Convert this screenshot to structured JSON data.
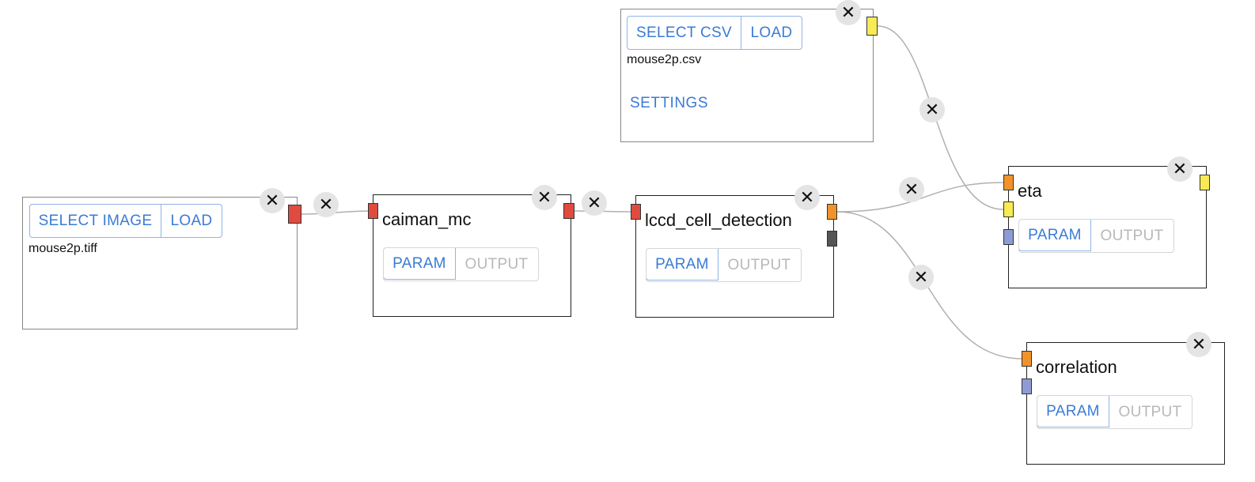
{
  "colors": {
    "port_image": "#e04b3f",
    "port_csv": "#f8ea55",
    "port_roi": "#f0932b",
    "port_iscell": "#555555",
    "port_input_aux": "#8e9bd4",
    "button_text": "#3a7bd5",
    "edge": "#b0b0b0"
  },
  "close_glyph": "✕",
  "nodes": {
    "image_input": {
      "select_label": "SELECT IMAGE",
      "load_label": "LOAD",
      "filename": "mouse2p.tiff"
    },
    "csv_input": {
      "select_label": "SELECT CSV",
      "load_label": "LOAD",
      "filename": "mouse2p.csv",
      "settings_label": "SETTINGS"
    },
    "caiman_mc": {
      "title": "caiman_mc",
      "param_label": "PARAM",
      "output_label": "OUTPUT"
    },
    "lccd": {
      "title": "lccd_cell_detection",
      "param_label": "PARAM",
      "output_label": "OUTPUT"
    },
    "eta": {
      "title": "eta",
      "param_label": "PARAM",
      "output_label": "OUTPUT"
    },
    "correlation": {
      "title": "correlation",
      "param_label": "PARAM",
      "output_label": "OUTPUT"
    }
  },
  "edges": [
    {
      "id": "image-to-caiman",
      "from": "image_input.output",
      "to": "caiman_mc.input"
    },
    {
      "id": "caiman-to-lccd",
      "from": "caiman_mc.output",
      "to": "lccd.input"
    },
    {
      "id": "lccd-to-eta",
      "from": "lccd.roi_output",
      "to": "eta.roi_input"
    },
    {
      "id": "csv-to-eta",
      "from": "csv_input.output",
      "to": "eta.csv_input"
    },
    {
      "id": "lccd-to-correlation",
      "from": "lccd.roi_output",
      "to": "correlation.roi_input"
    }
  ]
}
